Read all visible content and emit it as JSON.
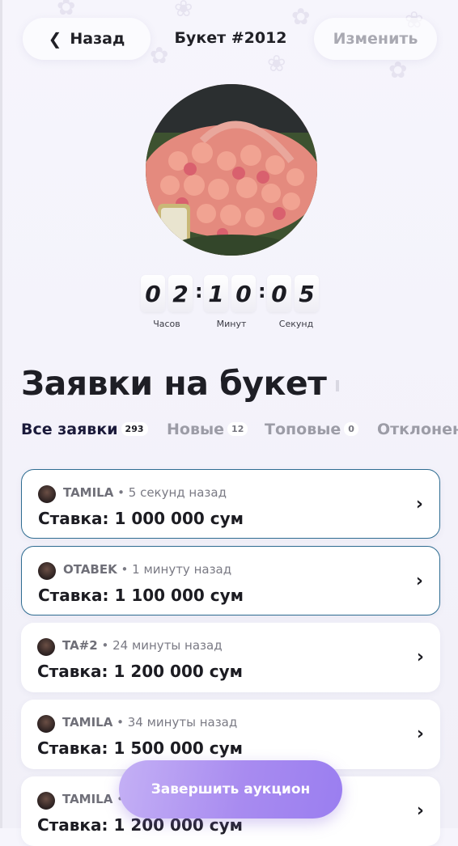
{
  "header": {
    "back_label": "Назад",
    "title": "Букет #2012",
    "edit_label": "Изменить"
  },
  "timer": {
    "hours": [
      "0",
      "2"
    ],
    "minutes": [
      "1",
      "0"
    ],
    "seconds": [
      "0",
      "5"
    ],
    "labels": {
      "hours": "Часов",
      "minutes": "Минут",
      "seconds": "Секунд"
    }
  },
  "section_title": "Заявки на букет",
  "tabs": [
    {
      "label": "Все заявки",
      "count": "293",
      "active": true
    },
    {
      "label": "Новые",
      "count": "12",
      "active": false
    },
    {
      "label": "Топовые",
      "count": "0",
      "active": false
    },
    {
      "label": "Отклонен",
      "count": "",
      "active": false
    }
  ],
  "bids": [
    {
      "name": "TAMILA",
      "time": "• 5 секунд назад",
      "amount": "Ставка: 1 000 000 сум"
    },
    {
      "name": "OTABEK",
      "time": "• 1 минуту назад",
      "amount": "Ставка: 1 100 000 сум"
    },
    {
      "name": "TA#2",
      "time": "• 24 минуты назад",
      "amount": "Ставка: 1 200 000 сум"
    },
    {
      "name": "TAMILA",
      "time": "• 34 минуты назад",
      "amount": "Ставка: 1 500 000 сум"
    },
    {
      "name": "TAMILA",
      "time": "•",
      "amount": "Ставка: 1 200 000 сум"
    }
  ],
  "finish_button": "Завершить аукцион",
  "colors": {
    "accent_purple": "#a88bf0",
    "highlight_border": "#2e6c91",
    "active_tab": "#1b1a3a",
    "muted": "#9c9ca6"
  },
  "icons": {
    "back": "chevron-left-icon",
    "row_arrow": "chevron-right-icon"
  }
}
